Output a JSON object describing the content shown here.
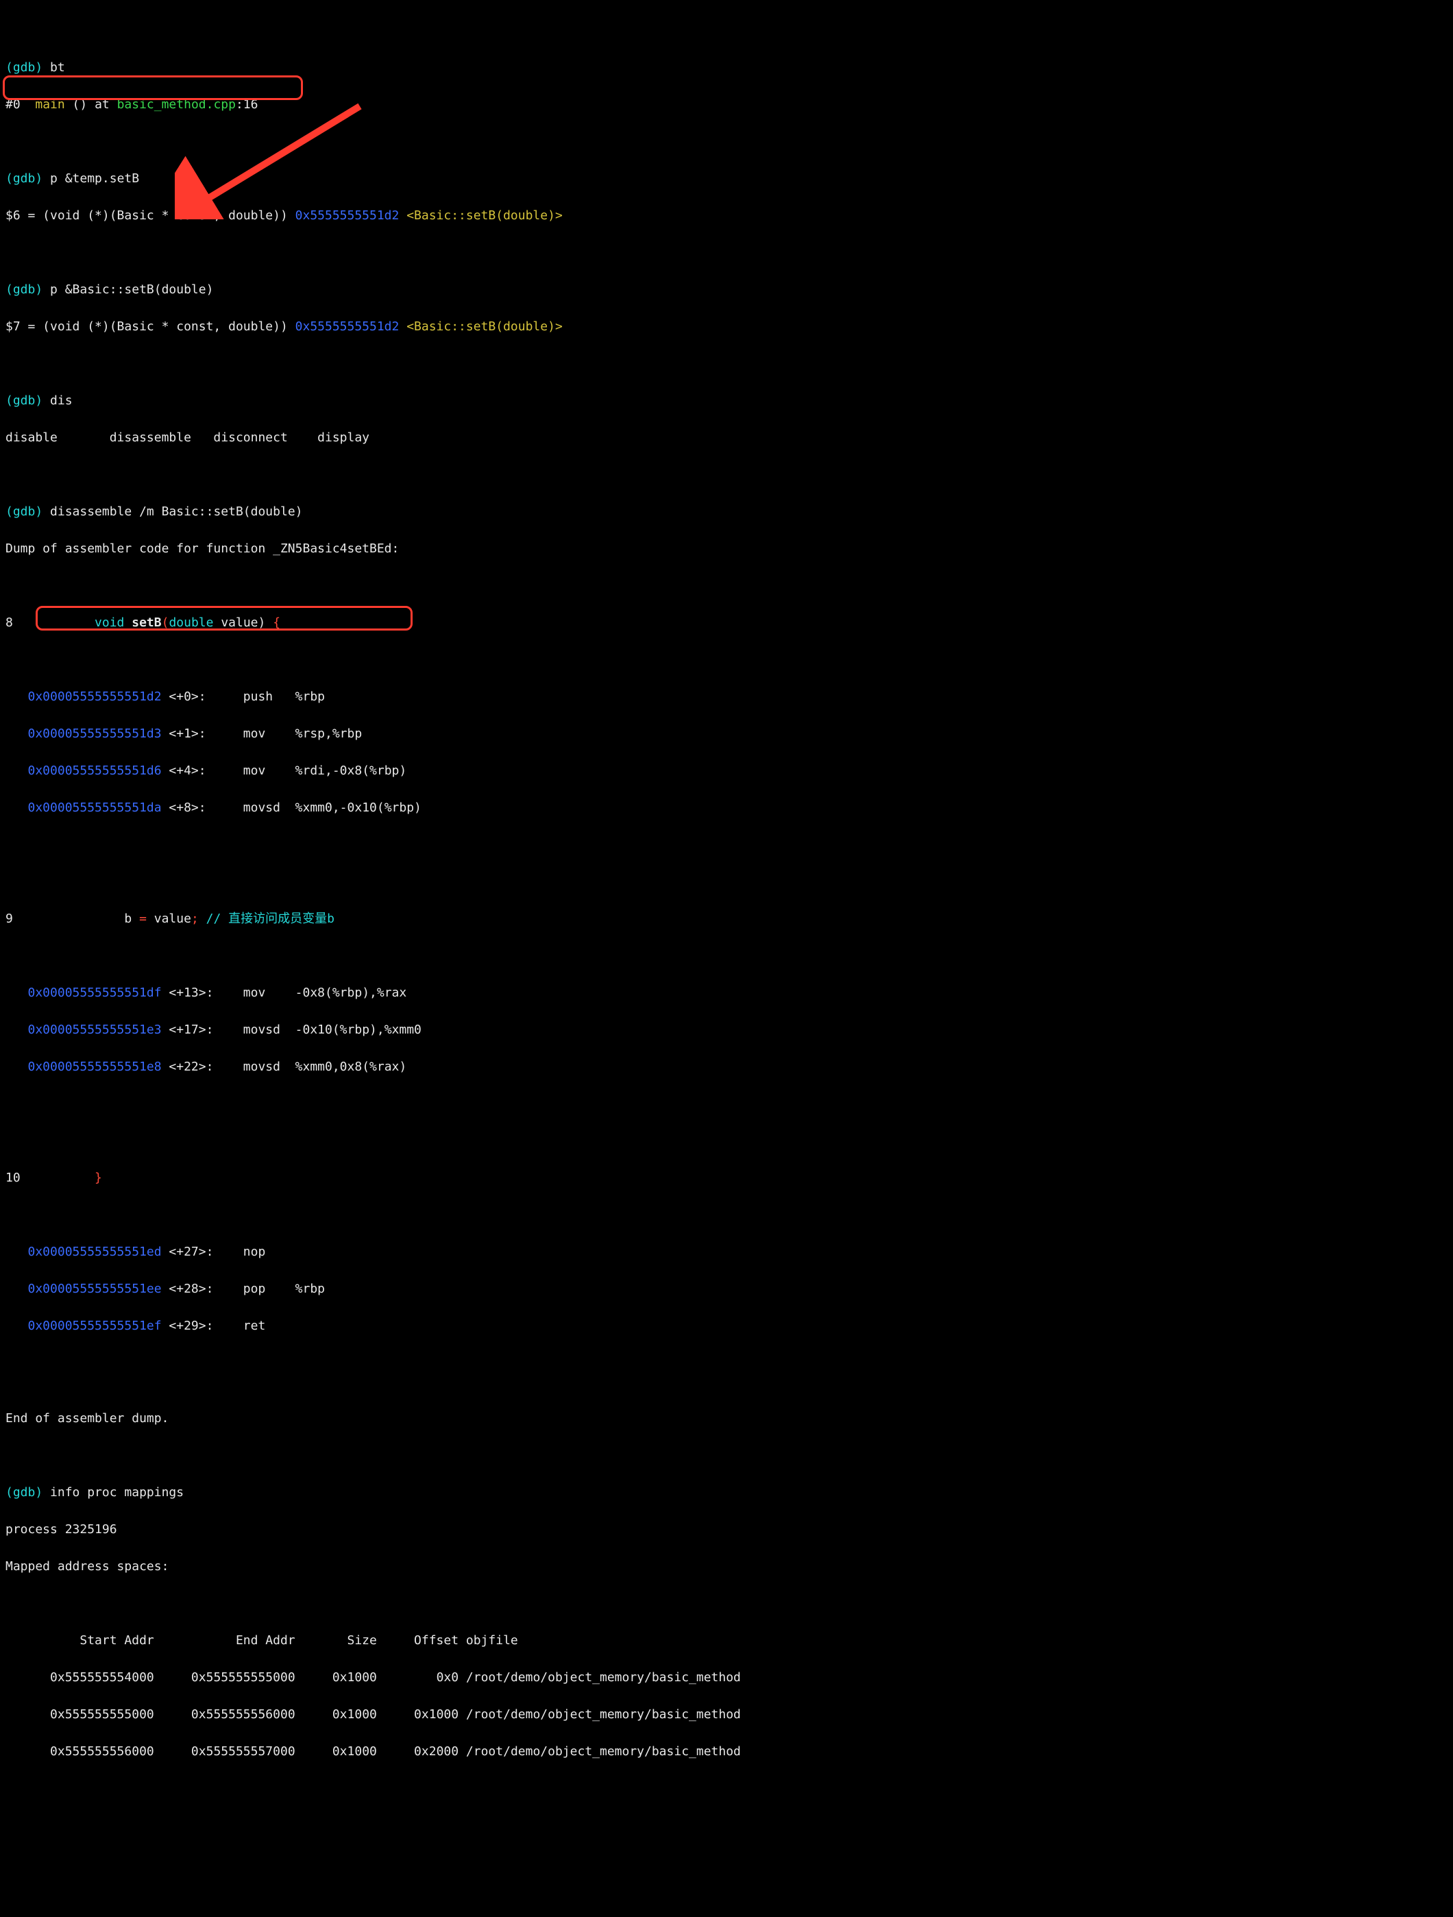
{
  "prompt": {
    "gdb": "(gdb)"
  },
  "cmd": {
    "bt": "bt",
    "p_temp_setB": "p &temp.setB",
    "p_basic_setB": "p &Basic::setB(double)",
    "dis": "dis",
    "disassemble_setB": "disassemble /m Basic::setB(double)",
    "info_proc": "info proc mappings"
  },
  "bt": {
    "frame": "#0  ",
    "func": "main",
    "rest": " () at ",
    "file": "basic_method.cpp",
    "line": ":16"
  },
  "print": {
    "var6_lead": "$6 = (void (*)(Basic * const, double)) ",
    "var6_addr": "0x5555555551d2",
    "var6_sym": "<Basic::setB(double)>",
    "var7_lead": "$7 = (void (*)(Basic * const, double)) ",
    "var7_addr": "0x5555555551d2",
    "var7_sym": "<Basic::setB(double)>"
  },
  "dis_completions": "disable       disassemble   disconnect    display",
  "dump_header": "Dump of assembler code for function _ZN5Basic4setBEd:",
  "src": {
    "l8_num": "8           ",
    "l8_kw": "void",
    "l8_sp": " ",
    "l8_fn": "setB",
    "l8_par": "(",
    "l8_ty": "double",
    "l8_rest": " value) ",
    "l8_brace": "{",
    "l9_num": "9               b ",
    "l9_eq": "=",
    "l9_val": " value",
    "l9_semi": ";",
    "l9_sp": " ",
    "l9_cmt": "// 直接访问成员变量b",
    "l10_num": "10          ",
    "l10_brace": "}"
  },
  "asm": {
    "a1": {
      "addr": "   0x00005555555551d2",
      "off": " <+0>:     ",
      "ins": "push   %rbp"
    },
    "a2": {
      "addr": "   0x00005555555551d3",
      "off": " <+1>:     ",
      "ins": "mov    %rsp,%rbp"
    },
    "a3": {
      "addr": "   0x00005555555551d6",
      "off": " <+4>:     ",
      "ins": "mov    %rdi,-0x8(%rbp)"
    },
    "a4": {
      "addr": "   0x00005555555551da",
      "off": " <+8>:     ",
      "ins": "movsd  %xmm0,-0x10(%rbp)"
    },
    "b1": {
      "addr": "   0x00005555555551df",
      "off": " <+13>:    ",
      "ins": "mov    -0x8(%rbp),%rax"
    },
    "b2": {
      "addr": "   0x00005555555551e3",
      "off": " <+17>:    ",
      "ins": "movsd  -0x10(%rbp),%xmm0"
    },
    "b3": {
      "addr": "   0x00005555555551e8",
      "off": " <+22>:    ",
      "ins": "movsd  %xmm0,0x8(%rax)"
    },
    "c1": {
      "addr": "   0x00005555555551ed",
      "off": " <+27>:    ",
      "ins": "nop"
    },
    "c2": {
      "addr": "   0x00005555555551ee",
      "off": " <+28>:    ",
      "ins": "pop    %rbp"
    },
    "c3": {
      "addr": "   0x00005555555551ef",
      "off": " <+29>:    ",
      "ins": "ret"
    }
  },
  "end_dump": "End of assembler dump.",
  "proc": {
    "pid": "process 2325196",
    "mapped": "Mapped address spaces:",
    "hdr": "          Start Addr           End Addr       Size     Offset objfile",
    "rows": [
      {
        "start": "      0x555555554000",
        "end": "     0x555555555000",
        "size": "     0x1000",
        "off": "        0x0 ",
        "obj": "/root/demo/object_memory/basic_method"
      },
      {
        "start": "      0x555555555000",
        "end": "     0x555555556000",
        "size": "     0x1000",
        "off": "     0x1000 ",
        "obj": "/root/demo/object_memory/basic_method"
      },
      {
        "start": "      0x555555556000",
        "end": "     0x555555557000",
        "size": "     0x1000",
        "off": "     0x2000 ",
        "obj": "/root/demo/object_memory/basic_method"
      }
    ]
  }
}
